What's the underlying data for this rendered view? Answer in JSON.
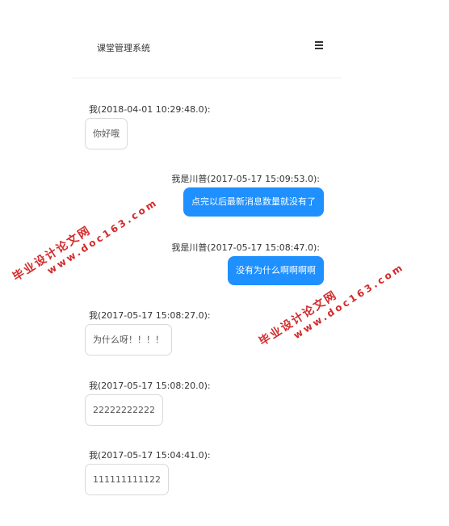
{
  "header": {
    "title": "课堂管理系统",
    "menu_icon": "hamburger-menu-icon"
  },
  "messages": [
    {
      "side": "left",
      "sender_meta": "我(2018-04-01 10:29:48.0):",
      "text": "你好哦"
    },
    {
      "side": "right",
      "sender_meta": "我是川普(2017-05-17 15:09:53.0):",
      "text": "点完以后最新消息数量就没有了"
    },
    {
      "side": "right",
      "sender_meta": "我是川普(2017-05-17 15:08:47.0):",
      "text": "没有为什么啊啊啊啊"
    },
    {
      "side": "left",
      "sender_meta": "我(2017-05-17 15:08:27.0):",
      "text": "为什么呀！！！！"
    },
    {
      "side": "left",
      "sender_meta": "我(2017-05-17 15:08:20.0):",
      "text": "22222222222"
    },
    {
      "side": "left",
      "sender_meta": "我(2017-05-17 15:04:41.0):",
      "text": "111111111122"
    }
  ],
  "colors": {
    "accent": "#1e90ff",
    "watermark": "#d42a2a"
  },
  "watermarks": [
    {
      "line1": "毕业设计论文网",
      "line2": "www.doc163.com"
    },
    {
      "line1": "毕业设计论文网",
      "line2": "www.doc163.com"
    }
  ]
}
